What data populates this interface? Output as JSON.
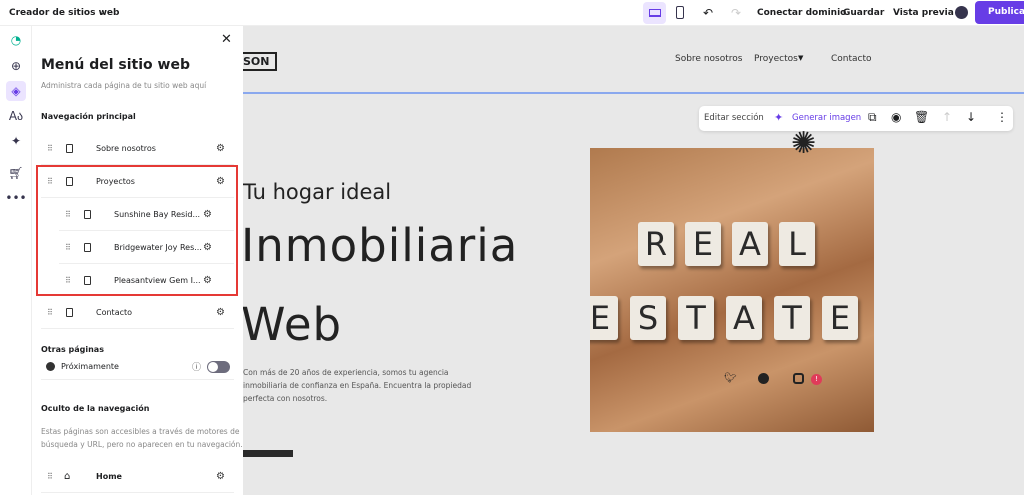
{
  "topbar": {
    "title": "Creador de sitios web",
    "connect": "Conectar dominio",
    "save": "Guardar",
    "preview": "Vista previa",
    "publish": "Publicar",
    "accent": "#673de6"
  },
  "panel": {
    "title": "Menú del sitio web",
    "subtitle": "Administra cada página de tu sitio web aquí",
    "main_nav": "Navegación principal",
    "items": [
      {
        "label": "Sobre nosotros"
      },
      {
        "label": "Proyectos"
      },
      {
        "label": "Sunshine Bay Resid..."
      },
      {
        "label": "Bridgewater Joy Res..."
      },
      {
        "label": "Pleasantview Gem I..."
      },
      {
        "label": "Contacto"
      }
    ],
    "other": "Otras páginas",
    "coming": "Próximamente",
    "hidden": "Oculto de la navegación",
    "hidden_desc1": "Estas páginas son accesibles a través de motores de",
    "hidden_desc2": "búsqueda y URL, pero no aparecen en tu navegación.",
    "home": "Home",
    "highlight": "#e53935"
  },
  "site": {
    "logo": "SON",
    "nav": [
      "Sobre nosotros",
      "Proyectos",
      "Contacto"
    ],
    "toolbar": {
      "edit": "Editar sección",
      "generate": "Generar imagen"
    },
    "hero_small": "Tu hogar ideal",
    "hero_big1": "Inmobiliaria",
    "hero_big2": "Web",
    "desc1": "Con más de 20 años de experiencia, somos tu agencia",
    "desc2": "inmobiliaria de confianza en España. Encuentra la propiedad",
    "desc3": "perfecta con nosotros.",
    "tiles1": [
      "R",
      "E",
      "A",
      "L"
    ],
    "tiles2": [
      "E",
      "S",
      "T",
      "A",
      "T",
      "E"
    ],
    "badge": "!"
  }
}
